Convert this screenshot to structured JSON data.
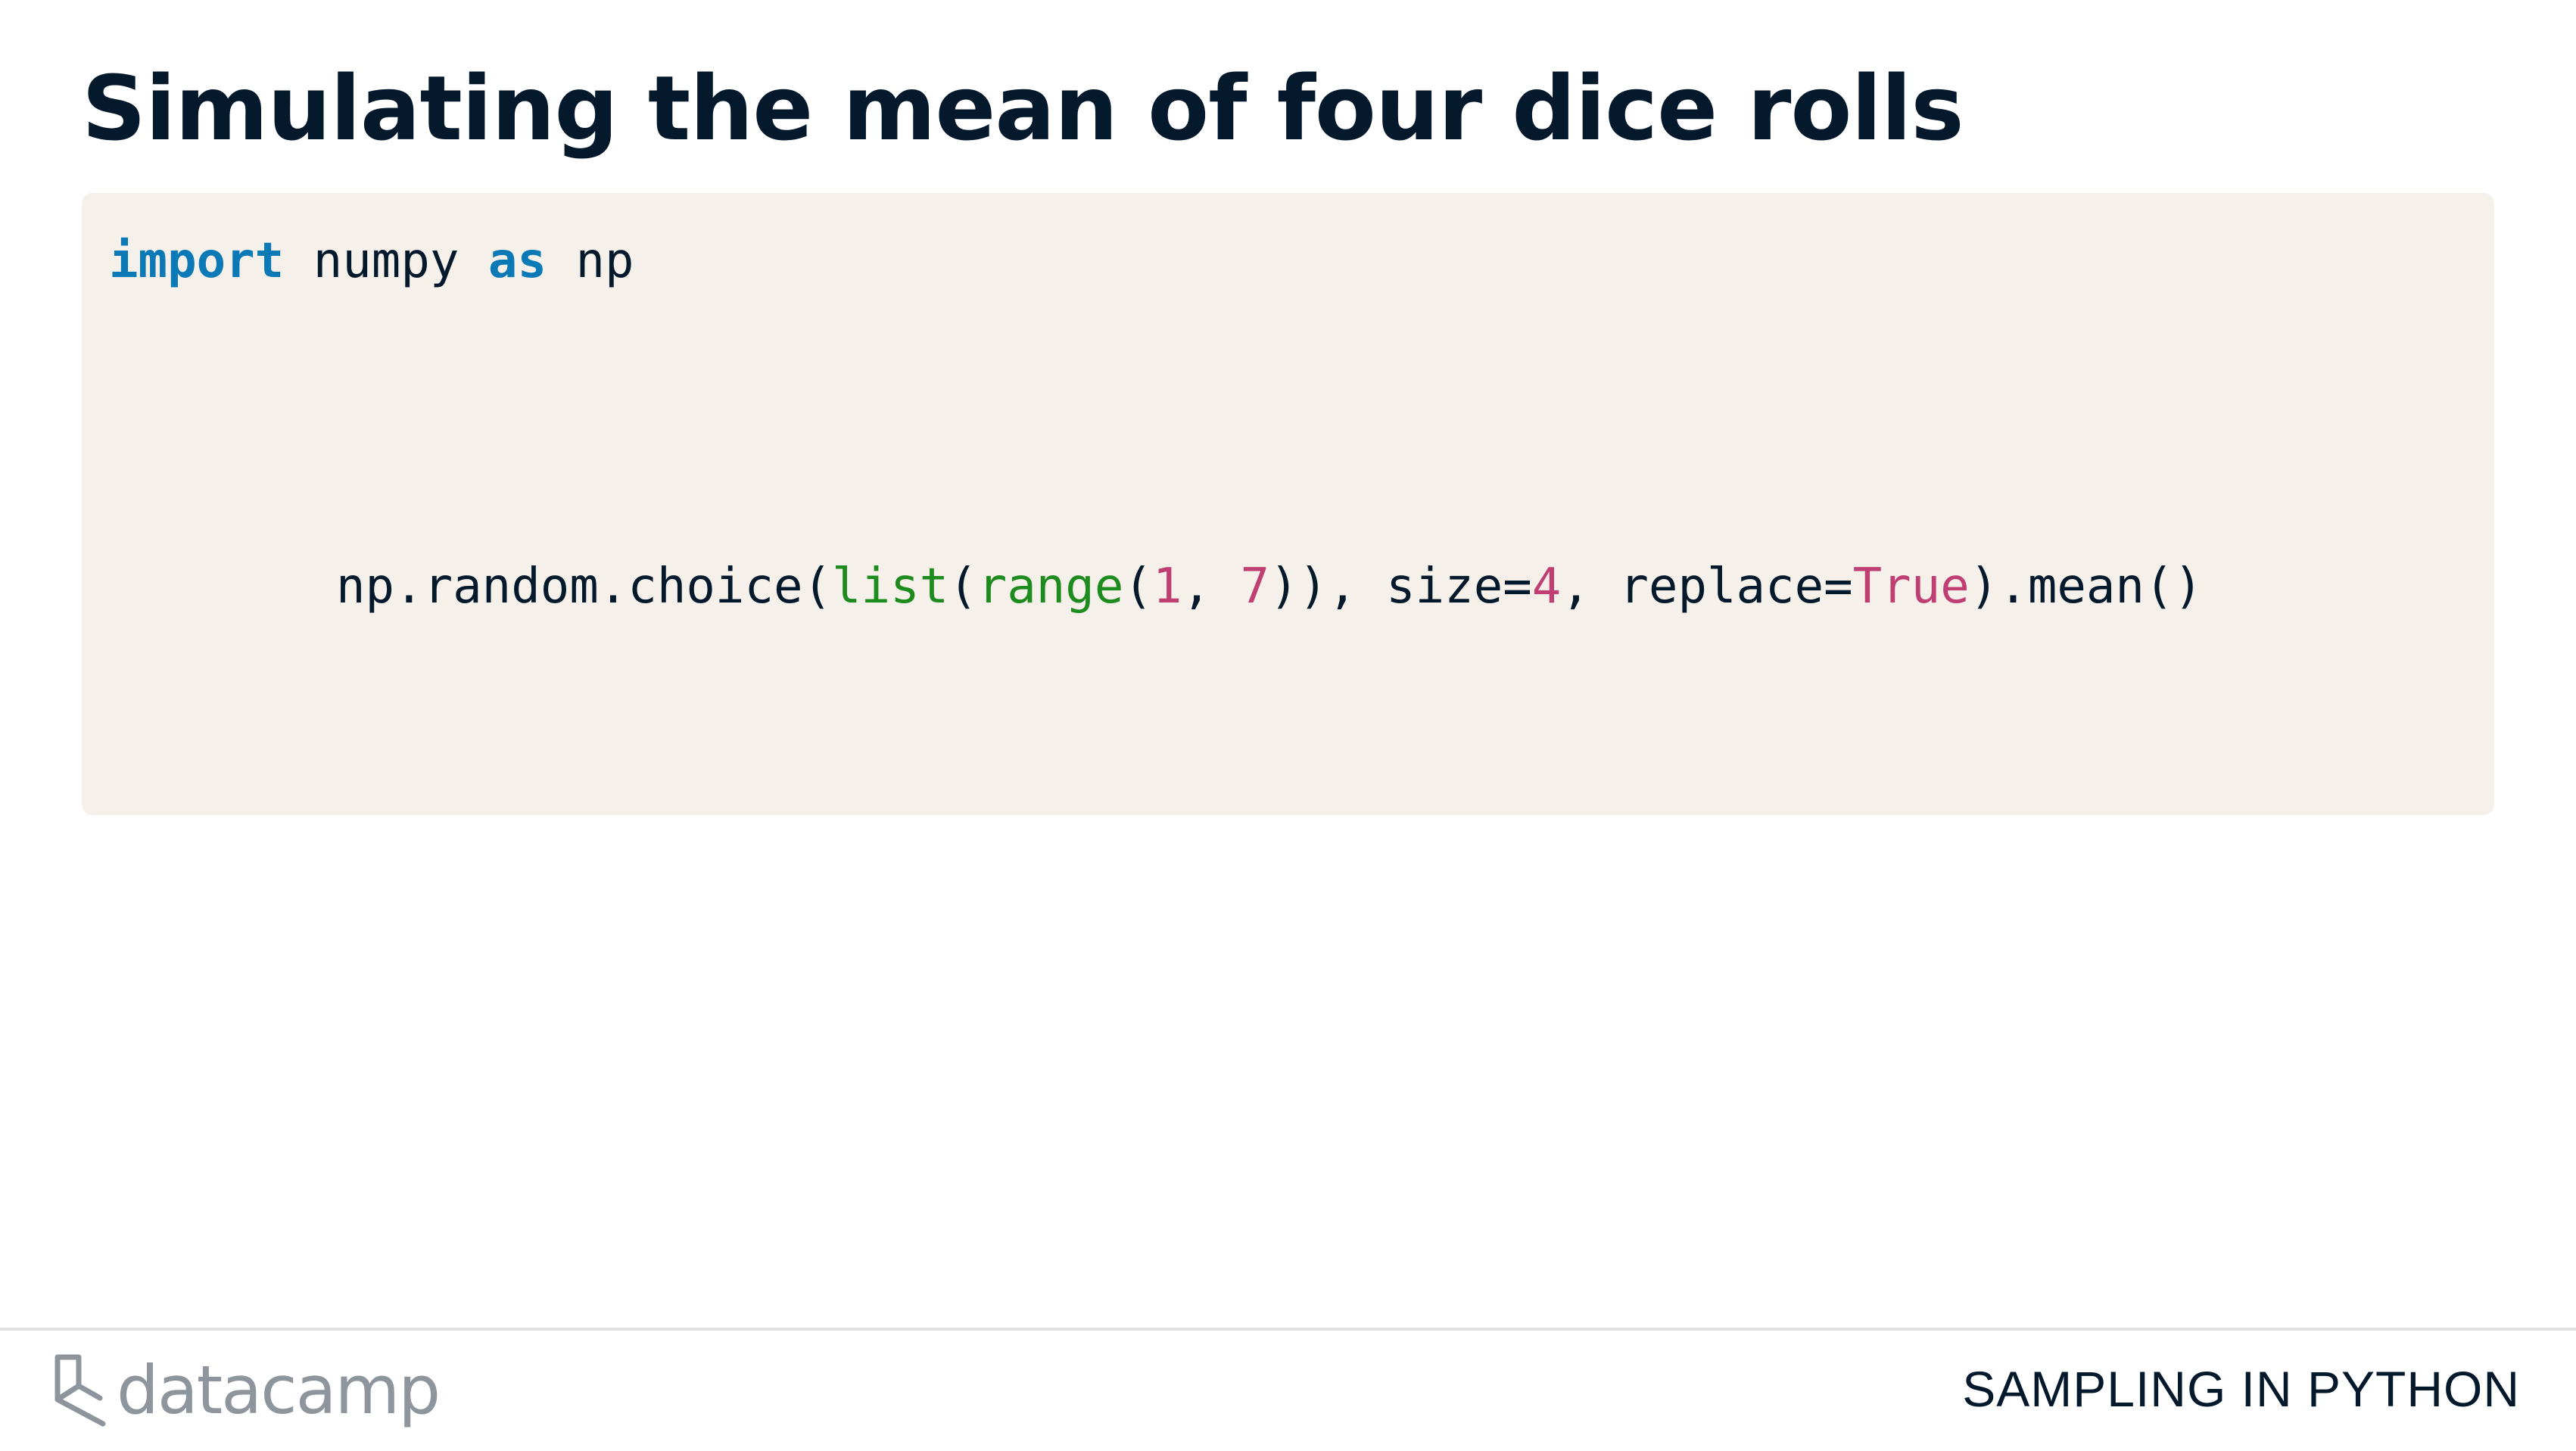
{
  "slide": {
    "title": "Simulating the mean of four dice rolls"
  },
  "code": {
    "line1": {
      "import_kw": "import",
      "module": " numpy ",
      "as_kw": "as",
      "alias": " np"
    },
    "line2": {
      "call": "np.random.choice(",
      "list_fn": "list",
      "paren_open": "(",
      "range_fn": "range",
      "paren_open2": "(",
      "arg1": "1",
      "comma1": ", ",
      "arg2": "7",
      "after_range": ")), size=",
      "size_val": "4",
      "after_size": ", replace=",
      "replace_val": "True",
      "tail": ").mean()"
    }
  },
  "footer": {
    "logo_text": "datacamp",
    "course_title": "SAMPLING IN PYTHON"
  },
  "colors": {
    "title": "#05192d",
    "code_background": "#f5f1ea",
    "keyword": "#0b79b5",
    "builtin": "#1e8b1e",
    "literal": "#c03f73",
    "logo": "#8f959c"
  }
}
